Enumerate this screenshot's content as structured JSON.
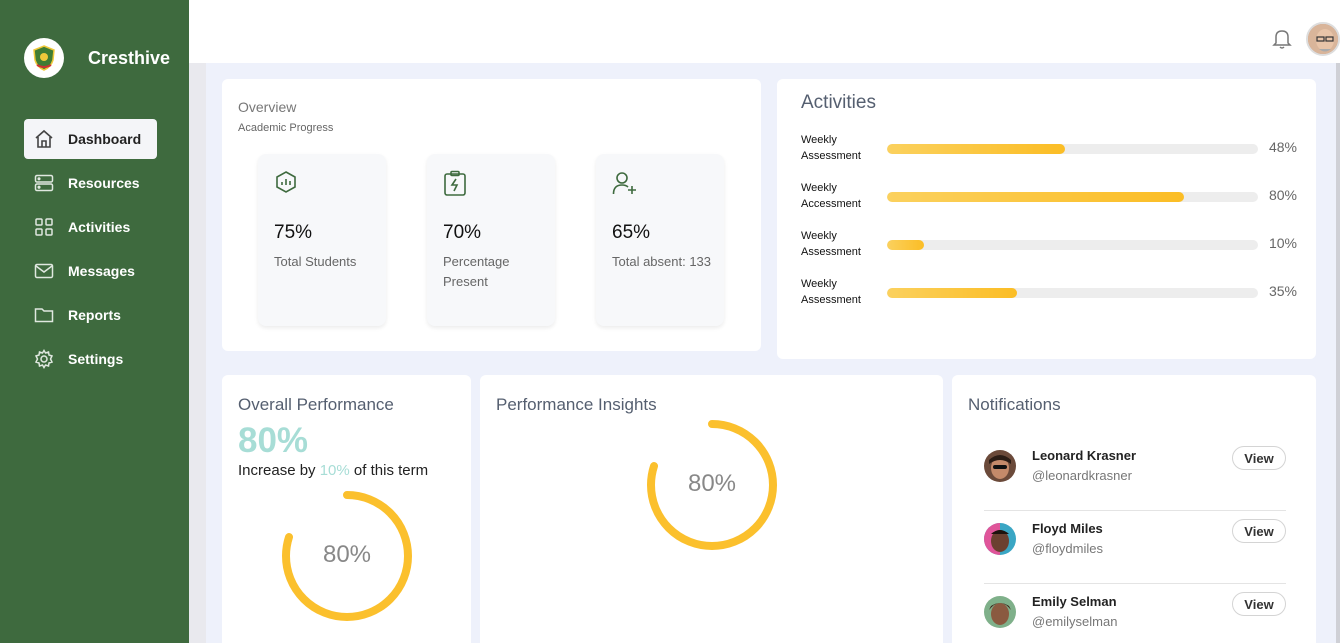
{
  "brand": {
    "name": "Cresthive"
  },
  "sidebar": {
    "items": [
      {
        "label": "Dashboard",
        "icon": "home-icon",
        "active": true
      },
      {
        "label": "Resources",
        "icon": "server-icon",
        "active": false
      },
      {
        "label": "Activities",
        "icon": "grid-icon",
        "active": false
      },
      {
        "label": "Messages",
        "icon": "mail-icon",
        "active": false
      },
      {
        "label": "Reports",
        "icon": "folder-icon",
        "active": false
      },
      {
        "label": "Settings",
        "icon": "gear-icon",
        "active": false
      }
    ]
  },
  "overview": {
    "title": "Overview",
    "subtitle": "Academic Progress",
    "stats": [
      {
        "value": "75%",
        "label": "Total Students",
        "icon": "chart-icon"
      },
      {
        "value": "70%",
        "label": "Percentage Present",
        "icon": "clipboard-icon"
      },
      {
        "value": "65%",
        "label": "Total absent: 133",
        "icon": "user-add-icon"
      }
    ]
  },
  "activities": {
    "title": "Activities",
    "rows": [
      {
        "label": "Weekly Assessment",
        "percent": 48,
        "percent_label": "48%"
      },
      {
        "label": "Weekly Accessment",
        "percent": 80,
        "percent_label": "80%"
      },
      {
        "label": "Weekly Assessment",
        "percent": 10,
        "percent_label": "10%"
      },
      {
        "label": "Weekly Assessment",
        "percent": 35,
        "percent_label": "35%"
      }
    ]
  },
  "overall_performance": {
    "title": "Overall Performance",
    "big_value": "80%",
    "increase_prefix": "Increase by",
    "increase_value": "10%",
    "increase_suffix": "of this term",
    "ring_value": 80,
    "ring_label": "80%"
  },
  "performance_insights": {
    "title": "Performance Insights",
    "ring_value": 80,
    "ring_label": "80%"
  },
  "notifications": {
    "title": "Notifications",
    "button_label": "View",
    "items": [
      {
        "name": "Leonard Krasner",
        "handle": "@leonardkrasner"
      },
      {
        "name": "Floyd Miles",
        "handle": "@floydmiles"
      },
      {
        "name": "Emily Selman",
        "handle": "@emilyselman"
      }
    ]
  },
  "colors": {
    "sidebar": "#3e6a3e",
    "accent_yellow": "#fbbd25",
    "accent_teal": "#a7ddd6"
  }
}
